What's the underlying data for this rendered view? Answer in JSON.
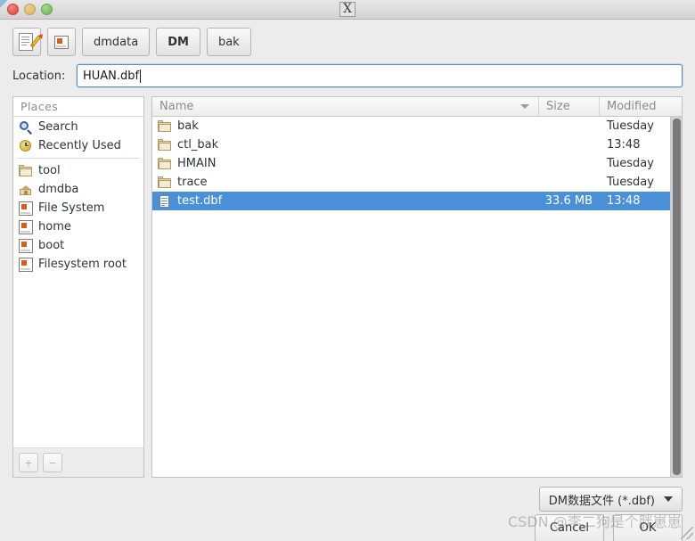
{
  "window": {
    "title_glyph": "X",
    "controls": [
      "close",
      "minimize",
      "maximize"
    ]
  },
  "toolbar": {
    "new_doc_icon": "new-document-pencil-icon",
    "drive_icon": "drive-icon",
    "crumbs": [
      {
        "label": "dmdata",
        "active": false
      },
      {
        "label": "DM",
        "active": true
      },
      {
        "label": "bak",
        "active": false
      }
    ]
  },
  "location": {
    "label": "Location:",
    "value": "HUAN.dbf",
    "placeholder": ""
  },
  "places": {
    "header": "Places",
    "items": [
      {
        "label": "Search",
        "icon": "search-icon"
      },
      {
        "label": "Recently Used",
        "icon": "recent-icon"
      },
      {
        "label": "tool",
        "icon": "folder-icon"
      },
      {
        "label": "dmdba",
        "icon": "home-folder-icon"
      },
      {
        "label": "File System",
        "icon": "drive-icon"
      },
      {
        "label": "home",
        "icon": "drive-icon"
      },
      {
        "label": "boot",
        "icon": "drive-icon"
      },
      {
        "label": "Filesystem root",
        "icon": "drive-icon"
      }
    ],
    "add_label": "+",
    "remove_label": "−"
  },
  "filelist": {
    "columns": [
      "Name",
      "Size",
      "Modified"
    ],
    "sort_indicator": "descending",
    "rows": [
      {
        "name": "bak",
        "size": "",
        "modified": "Tuesday",
        "icon": "folder-icon",
        "selected": false
      },
      {
        "name": "ctl_bak",
        "size": "",
        "modified": "13:48",
        "icon": "folder-icon",
        "selected": false
      },
      {
        "name": "HMAIN",
        "size": "",
        "modified": "Tuesday",
        "icon": "folder-icon",
        "selected": false
      },
      {
        "name": "trace",
        "size": "",
        "modified": "Tuesday",
        "icon": "folder-icon",
        "selected": false
      },
      {
        "name": "test.dbf",
        "size": "33.6 MB",
        "modified": "13:48",
        "icon": "file-icon",
        "selected": true
      }
    ]
  },
  "filter": {
    "selected": "DM数据文件 (*.dbf)",
    "options": [
      "DM数据文件 (*.dbf)"
    ]
  },
  "actions": {
    "cancel": "Cancel",
    "ok": "OK"
  },
  "watermark": "CSDN @李二狗是个胖崽崽",
  "colors": {
    "selection": "#4a90d9",
    "window_bg": "#ececec",
    "field_border": "#5a8fc4"
  }
}
